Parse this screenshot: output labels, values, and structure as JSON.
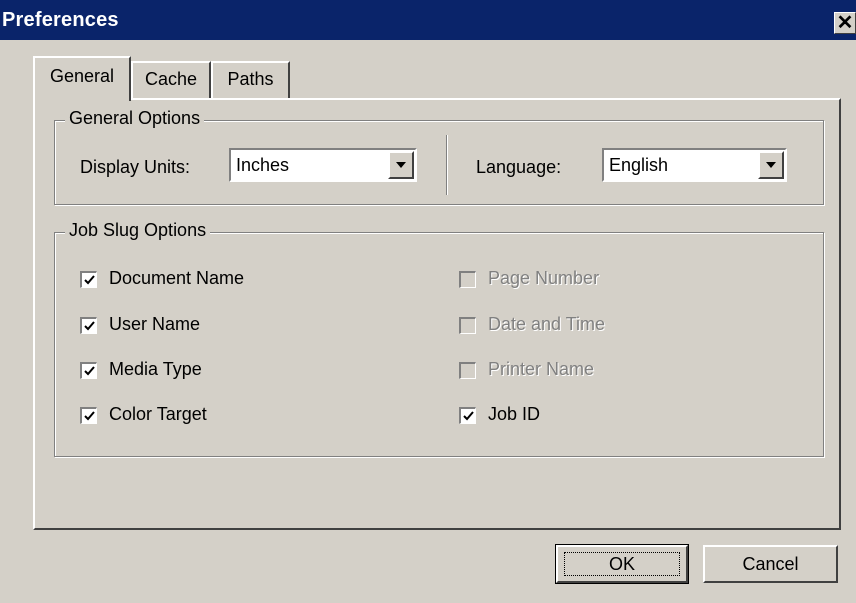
{
  "window": {
    "title": "Preferences",
    "close_glyph": "✕"
  },
  "tabs": [
    {
      "label": "General"
    },
    {
      "label": "Cache"
    },
    {
      "label": "Paths"
    }
  ],
  "general_options": {
    "title": "General Options",
    "display_units": {
      "label": "Display Units:",
      "value": "Inches"
    },
    "language": {
      "label": "Language:",
      "value": "English"
    }
  },
  "job_slug": {
    "title": "Job Slug Options",
    "left": [
      {
        "label": "Document Name",
        "checked": true,
        "enabled": true
      },
      {
        "label": "User Name",
        "checked": true,
        "enabled": true
      },
      {
        "label": "Media Type",
        "checked": true,
        "enabled": true
      },
      {
        "label": "Color Target",
        "checked": true,
        "enabled": true
      }
    ],
    "right": [
      {
        "label": "Page Number",
        "checked": false,
        "enabled": false
      },
      {
        "label": "Date and Time",
        "checked": false,
        "enabled": false
      },
      {
        "label": "Printer Name",
        "checked": false,
        "enabled": false
      },
      {
        "label": "Job ID",
        "checked": true,
        "enabled": true
      }
    ]
  },
  "buttons": {
    "ok": "OK",
    "cancel": "Cancel"
  },
  "icons": {
    "close": "close-icon",
    "dropdown": "dropdown-arrow-icon",
    "check": "checkmark-icon"
  }
}
